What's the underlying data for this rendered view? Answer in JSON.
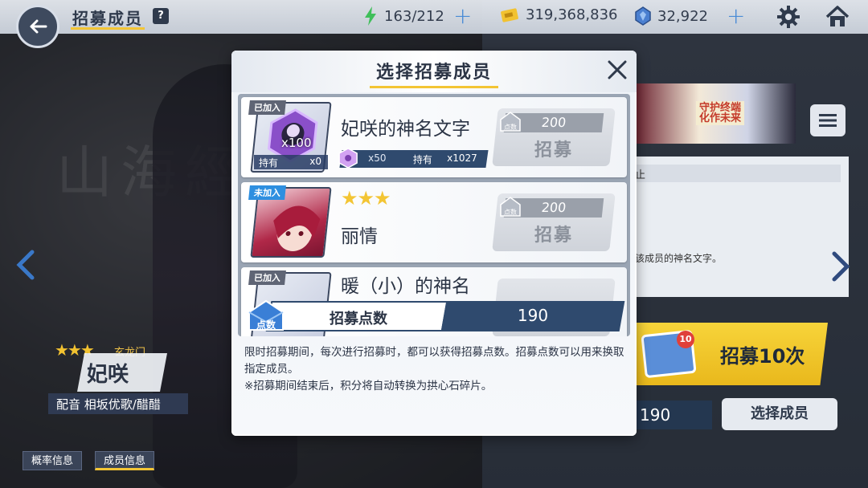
{
  "header": {
    "title": "招募成员",
    "help_icon": "?",
    "stamina": "163/212",
    "coins": "319,368,836",
    "gems": "32,922"
  },
  "background": {
    "calligraphy": "山海經"
  },
  "character": {
    "group": "玄龙门",
    "name": "妃咲",
    "cv": "配音 相坂优歌/醋醋",
    "tabs": [
      "概率信息",
      "成员信息"
    ]
  },
  "right_panel": {
    "banner_text": "守护终端\n化作未来",
    "info_line_1": "止",
    "info_line_2": "该成员的神名文字。",
    "draw10_badge": "10",
    "draw10_label": "招募10次",
    "points_value": "190",
    "select_label": "选择成员"
  },
  "modal": {
    "title": "选择招募成员",
    "members": [
      {
        "tag": "已加入",
        "name": "妃咲的神名文字",
        "portrait_qty": "x100",
        "own_label": "持有",
        "own_value": "x0",
        "frag_count": "x50",
        "hold_label": "持有",
        "hold_value": "x1027",
        "cost": "200",
        "cost_icon_label": "点数",
        "recruit_label": "招募"
      },
      {
        "tag": "未加入",
        "name": "丽情",
        "stars": "★★★",
        "cost": "200",
        "cost_icon_label": "点数",
        "recruit_label": "招募"
      },
      {
        "tag": "已加入",
        "name": "暖（小）的神名"
      }
    ],
    "points_icon_label": "点数",
    "points_label": "招募点数",
    "points_value": "190",
    "description": "限时招募期间，每次进行招募时，都可以获得招募点数。招募点数可以用来换取指定成员。\n※招募期间结束后，积分将自动转换为拱心石碎片。"
  },
  "colors": {
    "accent_yellow": "#f3c534",
    "navy": "#2f4a6e",
    "blue_tag": "#2e8fe0",
    "plus_blue": "#4a8bd6"
  }
}
